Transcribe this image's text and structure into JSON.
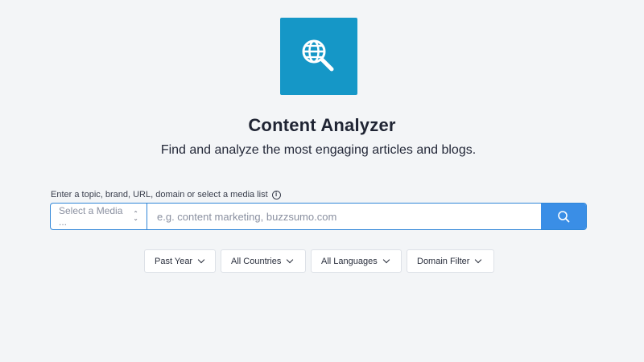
{
  "logo": {
    "icon": "globe-search-icon",
    "background": "#1597c7"
  },
  "header": {
    "title": "Content Analyzer",
    "subtitle": "Find and analyze the most engaging articles and blogs."
  },
  "search": {
    "label": "Enter a topic, brand, URL, domain or select a media list",
    "media_select": "Select a Media ...",
    "placeholder": "e.g. content marketing, buzzsumo.com",
    "value": "",
    "button_icon": "search-icon",
    "accent": "#3a8ee6"
  },
  "filters": [
    {
      "label": "Past Year"
    },
    {
      "label": "All Countries"
    },
    {
      "label": "All Languages"
    },
    {
      "label": "Domain Filter"
    }
  ]
}
